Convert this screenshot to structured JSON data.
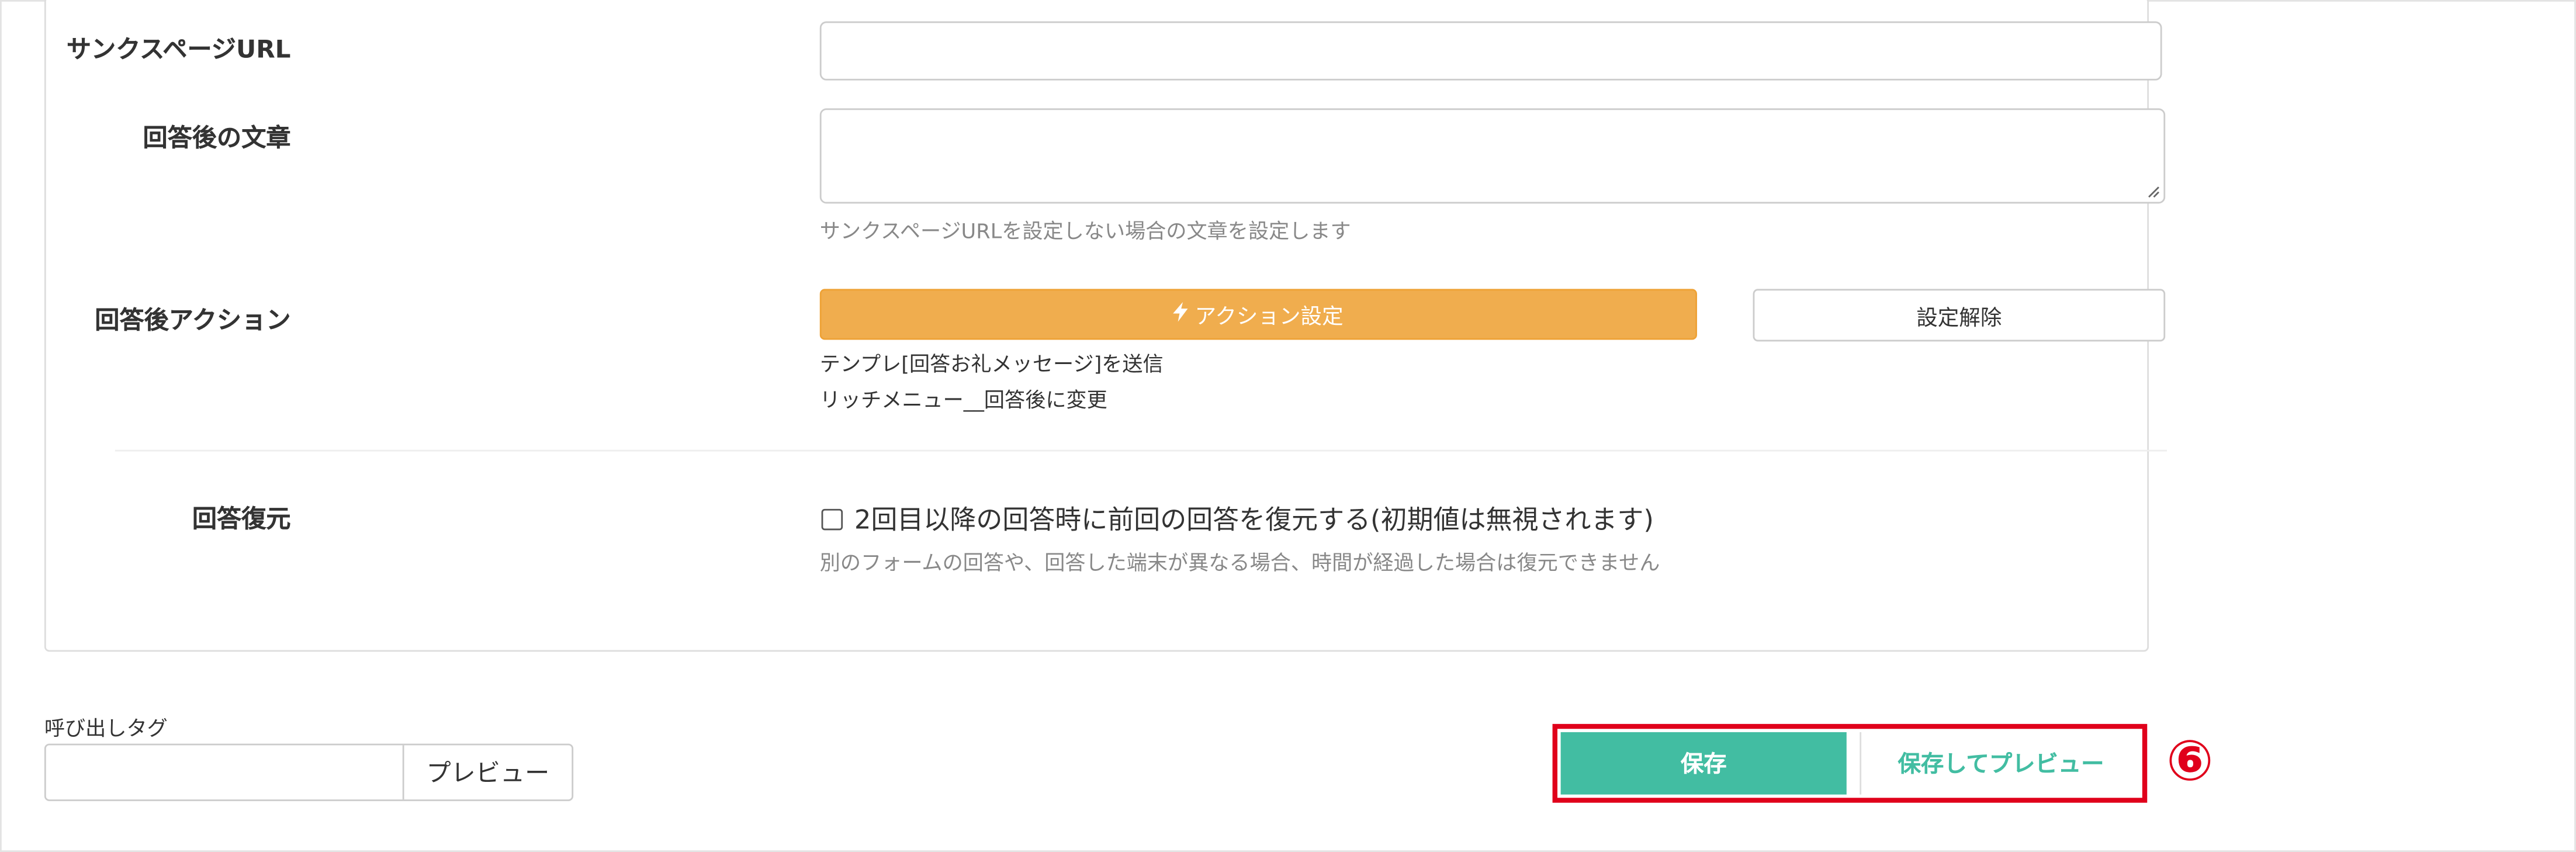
{
  "form": {
    "thanks_url_label": "サンクスページURL",
    "thanks_url_value": "",
    "after_text_label": "回答後の文章",
    "after_text_value": "",
    "after_text_help": "サンクスページURLを設定しない場合の文章を設定します",
    "after_action_label": "回答後アクション",
    "action_setting_button": "アクション設定",
    "action_clear_button": "設定解除",
    "action_lines": [
      "テンプレ[回答お礼メッセージ]を送信",
      "リッチメニュー__回答後に変更"
    ],
    "restore_label": "回答復元",
    "restore_checkbox_label": "2回目以降の回答時に前回の回答を復元する(初期値は無視されます)",
    "restore_checked": false,
    "restore_help": "別のフォームの回答や、回答した端末が異なる場合、時間が経過した場合は復元できません"
  },
  "call_tag": {
    "label": "呼び出しタグ",
    "value": "",
    "preview_button": "プレビュー"
  },
  "footer": {
    "save_button": "保存",
    "save_preview_button": "保存してプレビュー",
    "step_marker": "⑥"
  },
  "colors": {
    "accent": "#42bda2",
    "action": "#f0ad4e",
    "highlight": "#e0001b"
  },
  "icons": {
    "action": "lightning-bolt-icon"
  }
}
